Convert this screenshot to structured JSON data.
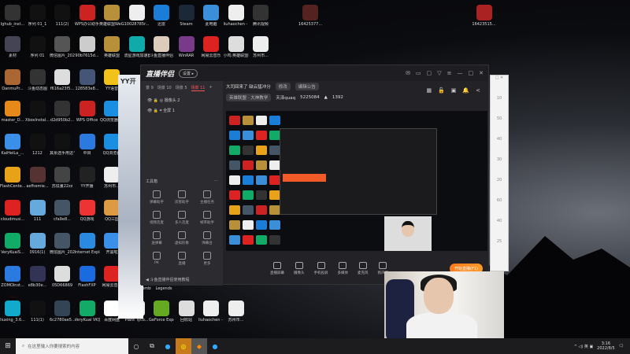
{
  "desktop": {
    "rows": [
      [
        [
          "lghub_inst...",
          "#333"
        ],
        [
          "序列 01_1",
          "#111"
        ],
        [
          "111(2)",
          "#111"
        ],
        [
          "WPS办公助手",
          "#c22"
        ],
        [
          "英雄联盟WeGame版",
          "#b8903a"
        ],
        [
          "10028785r...",
          "#eee"
        ],
        [
          "迅雷",
          "#1a7ed8"
        ],
        [
          "Steam",
          "#1b2838"
        ],
        [
          "此电脑",
          "#3a8fd8"
        ],
        [
          "liuhaochen - 快捷方式(2)",
          "#eee"
        ],
        [
          "腾讯视频",
          "#333"
        ],
        null,
        [
          "16425377...",
          "#522"
        ],
        null,
        null,
        null,
        null,
        null,
        null,
        [
          "16423515...",
          "#a22"
        ]
      ],
      [
        [
          "素材",
          "#445"
        ],
        [
          "序列 01",
          "#111"
        ],
        [
          "微信图片_2021102...",
          "#555"
        ],
        [
          "90b7615d...",
          "#ccc"
        ],
        [
          "英雄联盟",
          "#b8903a"
        ],
        [
          "流星游戏加速器",
          "#1aa"
        ],
        [
          "斗鱼直播伴侣",
          "#dcb"
        ],
        [
          "WinRAR",
          "#7a3a8a"
        ],
        [
          "网易云音乐",
          "#d22"
        ],
        [
          "小鸡:英雄联盟手(Skul Th...",
          "#ddd"
        ],
        [
          "苏州市...",
          "#eee"
        ]
      ],
      [
        [
          "DanmuPr...",
          "#a63"
        ],
        [
          "斗鱼动态图",
          "#333"
        ],
        [
          "f616a23f5...",
          "#ddd"
        ],
        [
          "128583e8...",
          "#457"
        ],
        [
          "YY语音",
          "#f2c21a"
        ]
      ],
      [
        [
          "master_D...",
          "#e58a1a"
        ],
        [
          "XboxInstal...",
          "#111"
        ],
        [
          "d2d950b2...",
          "#333"
        ],
        [
          "WPS Office",
          "#c22"
        ],
        [
          "QQ浏览器(2)",
          "#1a8ee0"
        ]
      ],
      [
        [
          "KaiHeiLa_...",
          "#3a8fe8"
        ],
        [
          "1212",
          "#111"
        ],
        [
          "其余选手用这个包...",
          "#111"
        ],
        [
          "中目",
          "#2a7ae0"
        ],
        [
          "QQ浏览器",
          "#1a8ee0"
        ]
      ],
      [
        [
          "FlashCente...",
          "#e8a21a"
        ],
        [
          "aefhemie...",
          "#533"
        ],
        [
          "苏炫董22zz",
          "#444"
        ],
        [
          "YY开播",
          "#222"
        ],
        [
          "苏州市...",
          "#eee"
        ]
      ],
      [
        [
          "cloudmusi...",
          "#d22"
        ],
        [
          "111",
          "#6ad"
        ],
        [
          "cfa9e8...",
          "#456"
        ],
        [
          "QQ游戏",
          "#e33"
        ],
        [
          "QQ三国",
          "#d94"
        ]
      ],
      [
        [
          "VeryKuaiS...",
          "#1a6"
        ],
        [
          "0916(1)",
          "#6ad"
        ],
        [
          "微信图片_2021111...",
          "#456"
        ],
        [
          "Internet Explorer",
          "#2a8ae0"
        ],
        [
          "开黑啦",
          "#3a8fe8"
        ]
      ],
      [
        [
          "ZOMOInst...",
          "#2a7ae0"
        ],
        [
          "e8b30e...",
          "#335"
        ],
        [
          "05D66869",
          "#ddd"
        ],
        [
          "FlashFXP",
          "#1a6ae0"
        ],
        [
          "网易云音乐",
          "#d22"
        ]
      ],
      [
        [
          "liuxing_3.6...",
          "#1ac"
        ],
        [
          "111(1)",
          "#111"
        ],
        [
          "6c2780ae5...",
          "#345"
        ],
        [
          "VeryKuai VK加速器",
          "#1a6"
        ],
        [
          "百度网盘",
          "#fff"
        ],
        [
          "Plant Tyco...",
          "#eee"
        ],
        [
          "GeForce Experience",
          "#6a2"
        ],
        [
          "回收站",
          "#ddd"
        ],
        [
          "liuhaochen - 快捷方式",
          "#eee"
        ],
        [
          "苏州市...",
          "#eee"
        ]
      ]
    ],
    "extra_labels": [
      "Plants Zombies G...",
      "Legends"
    ]
  },
  "yy": {
    "title": "YY开"
  },
  "app": {
    "logo": "直播伴侣",
    "pill": "设置 ▸",
    "title_icons": [
      "✉",
      "▭",
      "▢",
      "▽",
      "≡",
      "—",
      "□",
      "✕"
    ],
    "scene_tabs": [
      "景 9",
      "场景 10",
      "场景 5",
      "场景 11"
    ],
    "add": "+",
    "sources": [
      "摄像头 2",
      "全屏 1"
    ],
    "tools_title": "工具箱",
    "tools": [
      "弹幕助手",
      "房管助手",
      "主播任务",
      "视频连麦",
      "多人连麦",
      "帧率助手",
      "送弹幕",
      "虚拟形象",
      "弹幕台",
      "PK",
      "直播",
      "更多"
    ],
    "tip": "斗鱼直播伴侣使用教程",
    "room_title": "大司回来了 缺云猛冲分",
    "edit_chip": "修改",
    "category_chip": "英雄联盟 · 大神教学",
    "room": "天泽quaq",
    "room_id": "5225084",
    "heat": "1392",
    "notice": "编辑公告",
    "header_icons": [
      "▦",
      "🔓",
      "▣",
      "🔔",
      "<"
    ],
    "toolbar": [
      "直播屏幕",
      "摄像头",
      "手机投屏",
      "多媒体",
      "麦克风",
      "扬声器"
    ],
    "go_live": "开始直播(F1)"
  },
  "side": {
    "values": [
      "10",
      "50",
      "40",
      "30",
      "20",
      "60",
      "40",
      "25"
    ]
  },
  "taskbar": {
    "start": "⊞",
    "search": "在这里输入你要搜索的内容",
    "time": "3:16",
    "date": "2022/8/5",
    "tray": "^ ◁) 英 ▣"
  }
}
